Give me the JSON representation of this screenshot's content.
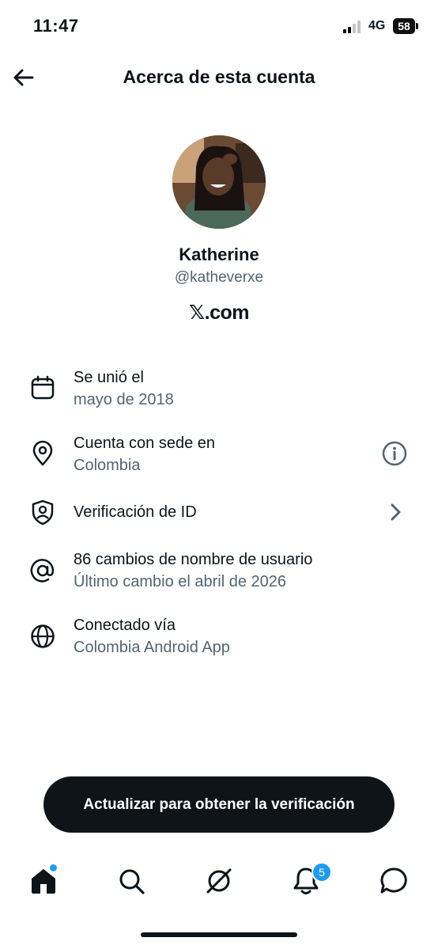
{
  "status_bar": {
    "time": "11:47",
    "network": "4G",
    "battery": "58"
  },
  "header": {
    "back_icon": "arrow-left-icon",
    "title": "Acerca de esta cuenta"
  },
  "profile": {
    "name": "Katherine",
    "handle": "@katheverxe",
    "platform": "𝕏.com"
  },
  "info_rows": [
    {
      "icon": "calendar-icon",
      "title": "Se unió el",
      "subtitle": "mayo de 2018"
    },
    {
      "icon": "location-pin-icon",
      "title": "Cuenta con sede en",
      "subtitle": "Colombia",
      "trailing": "info-icon"
    },
    {
      "icon": "id-shield-icon",
      "title": "Verificación de ID",
      "trailing": "chevron-right-icon"
    },
    {
      "icon": "at-sign-icon",
      "title": "86 cambios de nombre de usuario",
      "subtitle": "Último cambio el abril de 2026"
    },
    {
      "icon": "globe-icon",
      "title": "Conectado vía",
      "subtitle": "Colombia Android App"
    }
  ],
  "cta": {
    "label": "Actualizar para obtener la verificación"
  },
  "tab_bar": {
    "tabs": [
      "home-icon",
      "search-icon",
      "grok-icon",
      "notifications-icon",
      "messages-icon"
    ],
    "notifications_badge": "5"
  },
  "colors": {
    "text": "#0f1419",
    "secondary": "#536471",
    "accent": "#1d9bf0",
    "cta_background": "#0f1419"
  }
}
